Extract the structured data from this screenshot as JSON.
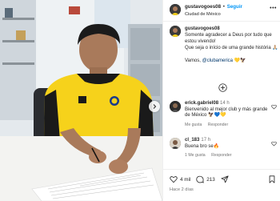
{
  "post": {
    "username": "gustavogoes08",
    "separator": "•",
    "follow_label": "Seguir",
    "location": "Ciudad de México",
    "more_icon": "more-horizontal-icon"
  },
  "caption": {
    "username": "gustavogoes08",
    "line1": "Somente agradecer a Deus por tudo que estou vivendo!",
    "line2": "Que seja o início de uma grande história 🙏🏼",
    "line3_prefix": "Vamos, ",
    "mention": "@clubamerica",
    "line3_suffix": " 💛🦅"
  },
  "comments": [
    {
      "username": "erick.gabriel08",
      "time": "14 h",
      "text": "Bienvenido al mejor club y más grande de México 🦅💙💛",
      "likes_label": "Me gusta",
      "reply_label": "Responder"
    },
    {
      "username": "cl_183",
      "time": "17 h",
      "text": "Buena bro se🔥",
      "likes_label": "1 Me gusta",
      "reply_label": "Responder"
    }
  ],
  "actions": {
    "likes": "4 mil",
    "comments": "213"
  },
  "posted_time": "Hace 2 días",
  "colors": {
    "follow": "#0095f6",
    "mention": "#00376b",
    "jersey": "#f6d21b"
  }
}
